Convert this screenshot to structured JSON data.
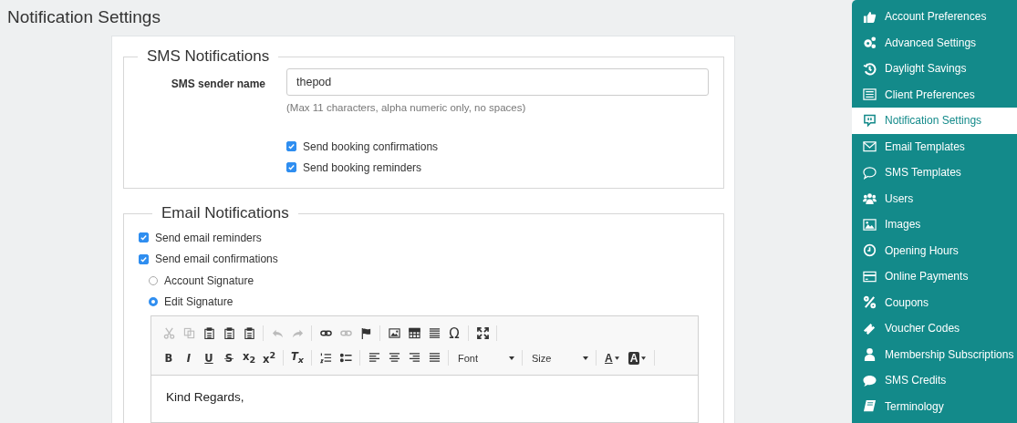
{
  "page_title": "Notification Settings",
  "sms": {
    "legend": "SMS Notifications",
    "sender_label": "SMS sender name",
    "sender_value": "thepod",
    "hint": "(Max 11 characters, alpha numeric only, no spaces)",
    "options": [
      {
        "label": "Send booking confirmations",
        "checked": true
      },
      {
        "label": "Send booking reminders",
        "checked": true
      }
    ]
  },
  "email": {
    "legend": "Email Notifications",
    "options": [
      {
        "label": "Send email reminders",
        "checked": true
      },
      {
        "label": "Send email confirmations",
        "checked": true
      }
    ],
    "signature": [
      {
        "label": "Account Signature",
        "selected": false
      },
      {
        "label": "Edit Signature",
        "selected": true
      }
    ],
    "toolbar_rows": [
      [
        {
          "kind": "cut",
          "disabled": true
        },
        {
          "kind": "copy",
          "disabled": true
        },
        {
          "kind": "paste",
          "disabled": false
        },
        {
          "kind": "paste",
          "disabled": false
        },
        {
          "kind": "paste",
          "disabled": false
        },
        {
          "kind": "separator"
        },
        {
          "kind": "undo",
          "disabled": true
        },
        {
          "kind": "redo",
          "disabled": true
        },
        {
          "kind": "separator"
        },
        {
          "kind": "link",
          "disabled": false
        },
        {
          "kind": "link",
          "disabled": true
        },
        {
          "kind": "flag",
          "disabled": false
        },
        {
          "kind": "separator"
        },
        {
          "kind": "image",
          "disabled": false
        },
        {
          "kind": "table",
          "disabled": false
        },
        {
          "kind": "lines",
          "disabled": false
        },
        {
          "kind": "symbol",
          "label": "Ω"
        },
        {
          "kind": "separator"
        },
        {
          "kind": "maximize",
          "disabled": false
        },
        {
          "kind": "separator"
        }
      ],
      [
        {
          "kind": "bold",
          "label": "B"
        },
        {
          "kind": "italic",
          "label": "I"
        },
        {
          "kind": "underline",
          "label": "U"
        },
        {
          "kind": "strike",
          "label": "S"
        },
        {
          "kind": "bold",
          "label": "x$_{2}$"
        },
        {
          "kind": "bold",
          "label": "x$^{2}$"
        },
        {
          "kind": "separator"
        },
        {
          "kind": "italic",
          "label": "T$_{x}$"
        },
        {
          "kind": "separator"
        },
        {
          "kind": "numlist",
          "disabled": false
        },
        {
          "kind": "bullist",
          "disabled": false
        },
        {
          "kind": "separator"
        },
        {
          "kind": "alignleft",
          "disabled": false
        },
        {
          "kind": "aligncenter",
          "disabled": false
        },
        {
          "kind": "alignright",
          "disabled": false
        },
        {
          "kind": "justify",
          "disabled": false
        },
        {
          "kind": "separator"
        },
        {
          "kind": "select",
          "label": "Font"
        },
        {
          "kind": "separator"
        },
        {
          "kind": "select",
          "label": "Size"
        },
        {
          "kind": "separator"
        },
        {
          "kind": "textcolor",
          "label": "A"
        },
        {
          "kind": "bgcolor",
          "label": "A"
        },
        {
          "kind": "separator"
        }
      ]
    ],
    "content": "Kind Regards,"
  },
  "sidebar": [
    {
      "label": "Account Preferences",
      "selected": false
    },
    {
      "label": "Advanced Settings",
      "selected": false
    },
    {
      "label": "Daylight Savings",
      "selected": false
    },
    {
      "label": "Client Preferences",
      "selected": false
    },
    {
      "label": "Notification Settings",
      "selected": true
    },
    {
      "label": "Email Templates",
      "selected": false
    },
    {
      "label": "SMS Templates",
      "selected": false
    },
    {
      "label": "Users",
      "selected": false
    },
    {
      "label": "Images",
      "selected": false
    },
    {
      "label": "Opening Hours",
      "selected": false
    },
    {
      "label": "Online Payments",
      "selected": false
    },
    {
      "label": "Coupons",
      "selected": false
    },
    {
      "label": "Voucher Codes",
      "selected": false
    },
    {
      "label": "Membership Subscriptions",
      "selected": false
    },
    {
      "label": "SMS Credits",
      "selected": false
    },
    {
      "label": "Terminology",
      "selected": false
    }
  ]
}
